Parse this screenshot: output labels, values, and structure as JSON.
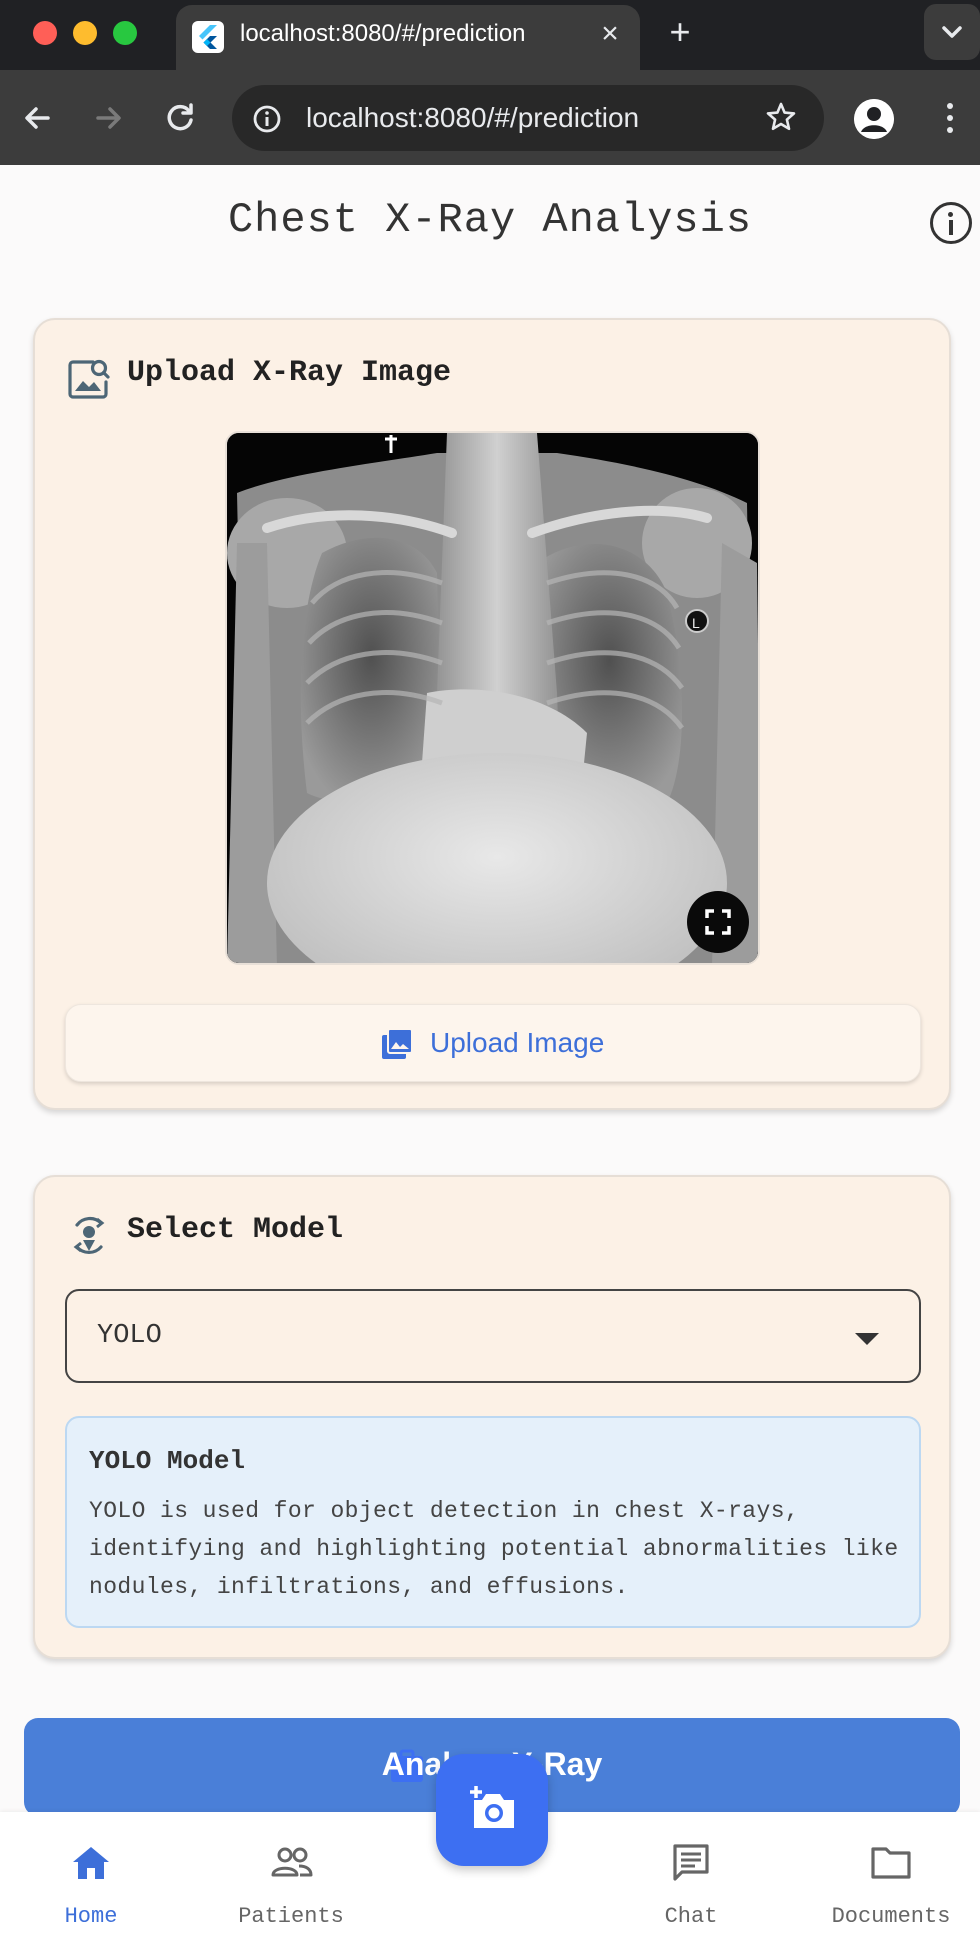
{
  "browser": {
    "tab_title": "localhost:8080/#/prediction",
    "url": "localhost:8080/#/prediction"
  },
  "app": {
    "title": "Chest X-Ray Analysis"
  },
  "upload_card": {
    "title": "Upload X-Ray Image",
    "upload_button": "Upload Image"
  },
  "model_card": {
    "title": "Select Model",
    "selected_model": "YOLO",
    "info_title": "YOLO Model",
    "info_text": "YOLO is used for object detection in chest X-rays, identifying and highlighting potential abnormalities like nodules, infiltrations, and effusions."
  },
  "analyze_button": "Analyze X-Ray",
  "bottom_nav": {
    "home": "Home",
    "patients": "Patients",
    "chat": "Chat",
    "documents": "Documents"
  },
  "colors": {
    "accent": "#3d6fd9",
    "card_bg": "#fcf1e6",
    "info_bg": "#e5f0fa"
  }
}
